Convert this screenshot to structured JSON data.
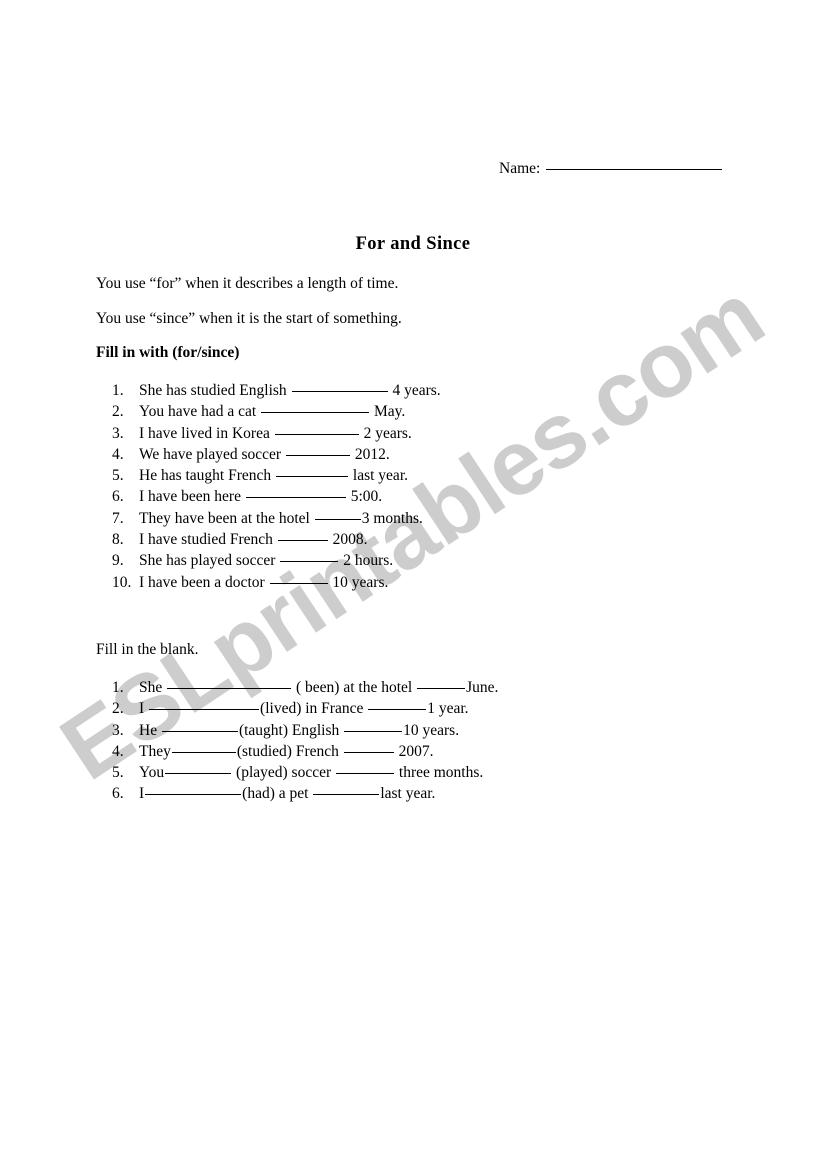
{
  "header": {
    "name_label": "Name:"
  },
  "title": "For and Since",
  "intro": {
    "line1": "You use “for” when it describes a length of time.",
    "line2": "You use “since” when it is the start of something."
  },
  "sections": [
    {
      "heading": "Fill in with (for/since)",
      "heading_bold": true,
      "items": [
        {
          "num": "1.",
          "pre": "She has studied English ",
          "blank_w": 96,
          "post": " 4 years."
        },
        {
          "num": "2.",
          "pre": "You have had a cat ",
          "blank_w": 108,
          "post": " May."
        },
        {
          "num": "3.",
          "pre": "I have lived in Korea ",
          "blank_w": 84,
          "post": " 2 years."
        },
        {
          "num": "4.",
          "pre": "We have played soccer ",
          "blank_w": 64,
          "post": " 2012."
        },
        {
          "num": "5.",
          "pre": "He has taught French ",
          "blank_w": 72,
          "post": " last year."
        },
        {
          "num": "6.",
          "pre": "I have been here ",
          "blank_w": 100,
          "post": " 5:00."
        },
        {
          "num": "7.",
          "pre": "They have been at the hotel ",
          "blank_w": 46,
          "post": "3 months."
        },
        {
          "num": "8.",
          "pre": "I have studied French ",
          "blank_w": 50,
          "post": " 2008."
        },
        {
          "num": "9.",
          "pre": "She has played soccer ",
          "blank_w": 58,
          "post": " 2 hours."
        },
        {
          "num": "10.",
          "pre": "I have been a doctor ",
          "blank_w": 58,
          "post": " 10 years."
        }
      ]
    },
    {
      "heading": "Fill in the blank.",
      "heading_bold": false,
      "items": [
        {
          "num": "1.",
          "pre": "She ",
          "blank_w": 124,
          "post": " ( been) at the hotel ",
          "blank2_w": 48,
          "post2": "June."
        },
        {
          "num": "2.",
          "pre": "I ",
          "blank_w": 110,
          "post": "(lived) in France ",
          "blank2_w": 58,
          "post2": "1 year."
        },
        {
          "num": "3.",
          "pre": "He ",
          "blank_w": 76,
          "post": "(taught) English ",
          "blank2_w": 58,
          "post2": "10 years."
        },
        {
          "num": "4.",
          "pre": "They",
          "blank_w": 64,
          "post": "(studied) French ",
          "blank2_w": 50,
          "post2": " 2007."
        },
        {
          "num": "5.",
          "pre": "You",
          "blank_w": 66,
          "post": " (played) soccer ",
          "blank2_w": 58,
          "post2": " three months."
        },
        {
          "num": "6.",
          "pre": "I",
          "blank_w": 96,
          "post": "(had) a pet ",
          "blank2_w": 66,
          "post2": "last year."
        }
      ]
    }
  ],
  "watermark": {
    "text": "ESLprintables.com",
    "color": "#cdcdcd"
  }
}
